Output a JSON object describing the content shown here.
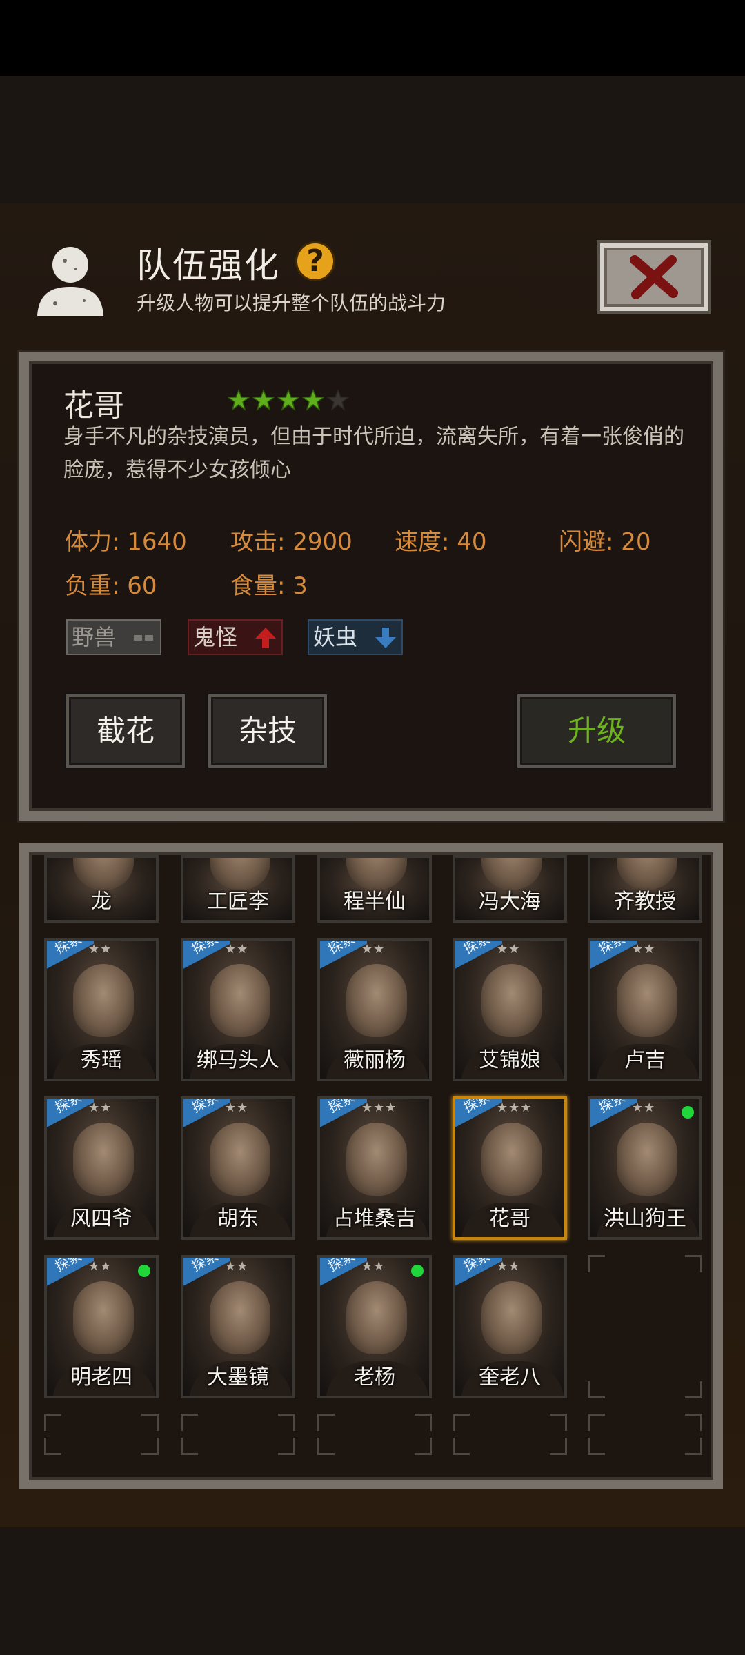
{
  "header": {
    "title": "队伍强化",
    "help_icon": "?",
    "subtitle": "升级人物可以提升整个队伍的战斗力"
  },
  "character": {
    "name": "花哥",
    "stars_filled": 4,
    "stars_total": 5,
    "description": "身手不凡的杂技演员，但由于时代所迫，流离失所，有着一张俊俏的脸庞，惹得不少女孩倾心",
    "stats": {
      "stamina": "体力: 1640",
      "attack": "攻击: 2900",
      "speed": "速度: 40",
      "dodge": "闪避: 20",
      "load": "负重: 60",
      "food": "食量: 3"
    },
    "tags": [
      {
        "label": "野兽",
        "effect": "neutral"
      },
      {
        "label": "鬼怪",
        "effect": "up"
      },
      {
        "label": "妖虫",
        "effect": "down"
      }
    ]
  },
  "buttons": {
    "skill1": "截花",
    "skill2": "杂技",
    "upgrade": "升级"
  },
  "roster": {
    "explore_label": "探索",
    "top_row": [
      "龙",
      "工匠李",
      "程半仙",
      "冯大海",
      "齐教授"
    ],
    "cards": [
      {
        "name": "秀瑶",
        "explore": true,
        "stars": "★★",
        "dot": false,
        "selected": false
      },
      {
        "name": "绑马头人",
        "explore": true,
        "stars": "★★",
        "dot": false,
        "selected": false
      },
      {
        "name": "薇丽杨",
        "explore": true,
        "stars": "★★",
        "dot": false,
        "selected": false
      },
      {
        "name": "艾锦娘",
        "explore": true,
        "stars": "★★",
        "dot": false,
        "selected": false
      },
      {
        "name": "卢吉",
        "explore": true,
        "stars": "★★",
        "dot": false,
        "selected": false
      },
      {
        "name": "风四爷",
        "explore": true,
        "stars": "★★",
        "dot": false,
        "selected": false
      },
      {
        "name": "胡东",
        "explore": true,
        "stars": "★★",
        "dot": false,
        "selected": false
      },
      {
        "name": "占堆桑吉",
        "explore": true,
        "stars": "★★★",
        "dot": false,
        "selected": false
      },
      {
        "name": "花哥",
        "explore": true,
        "stars": "★★★",
        "dot": false,
        "selected": true
      },
      {
        "name": "洪山狗王",
        "explore": true,
        "stars": "★★",
        "dot": true,
        "selected": false
      },
      {
        "name": "明老四",
        "explore": true,
        "stars": "★★",
        "dot": true,
        "selected": false
      },
      {
        "name": "大墨镜",
        "explore": true,
        "stars": "★★",
        "dot": false,
        "selected": false
      },
      {
        "name": "老杨",
        "explore": true,
        "stars": "★★",
        "dot": true,
        "selected": false
      },
      {
        "name": "奎老八",
        "explore": true,
        "stars": "★★",
        "dot": false,
        "selected": false
      }
    ]
  },
  "colors": {
    "accent_orange": "#d68a3c",
    "upgrade_green": "#6cb31d",
    "explore_blue": "#2f77b8",
    "selected_border": "#c9860f",
    "status_dot": "#21d63a"
  }
}
